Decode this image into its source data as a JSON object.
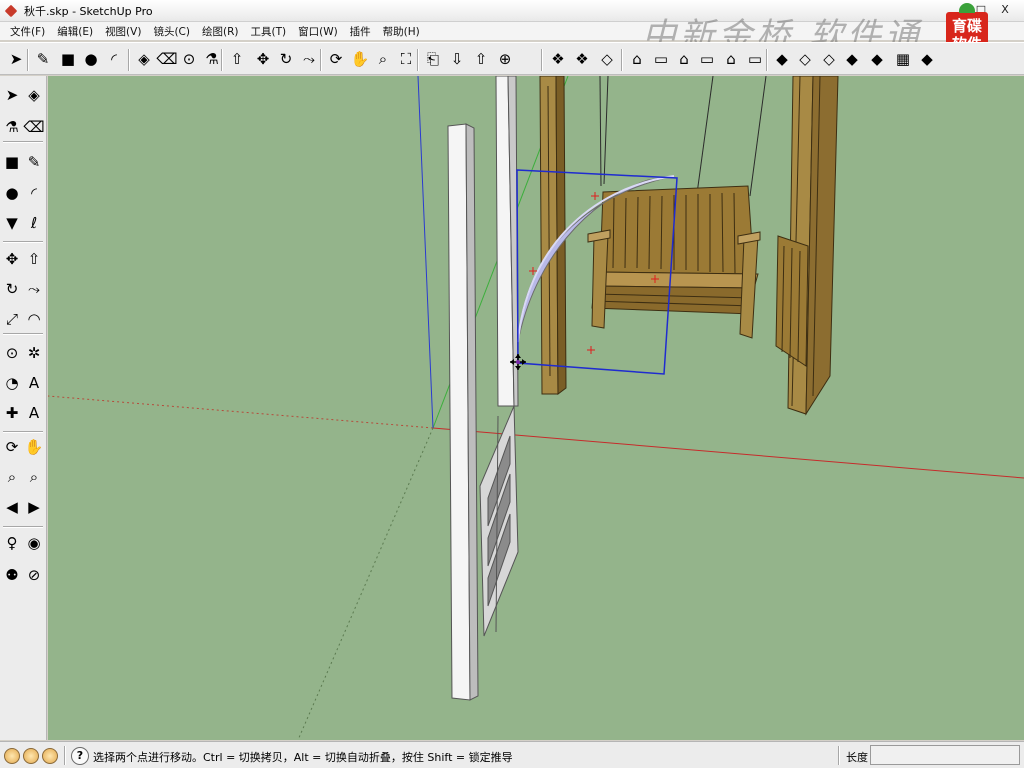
{
  "window": {
    "title": "秋千.skp - SketchUp Pro",
    "minimize_glyph": "–",
    "maximize_glyph": "□",
    "close_glyph": "X"
  },
  "menu": [
    {
      "label": "文件(F)"
    },
    {
      "label": "编辑(E)"
    },
    {
      "label": "视图(V)"
    },
    {
      "label": "镜头(C)"
    },
    {
      "label": "绘图(R)"
    },
    {
      "label": "工具(T)"
    },
    {
      "label": "窗口(W)"
    },
    {
      "label": "插件"
    },
    {
      "label": "帮助(H)"
    }
  ],
  "watermark": {
    "text": "中新金桥 软件通",
    "logo_text": "育碟软件"
  },
  "toolbar": {
    "items": [
      {
        "icon": "select-arrow-icon",
        "glyph": "➤"
      },
      {
        "icon": "pencil-line-icon",
        "glyph": "✎"
      },
      {
        "icon": "rectangle-icon",
        "glyph": "■"
      },
      {
        "icon": "circle-icon",
        "glyph": "●"
      },
      {
        "icon": "arc-icon",
        "glyph": "◜"
      },
      {
        "icon": "make-component-icon",
        "glyph": "◈"
      },
      {
        "icon": "eraser-icon",
        "glyph": "⌫"
      },
      {
        "icon": "tape-measure-icon",
        "glyph": "⊙"
      },
      {
        "icon": "paint-bucket-icon",
        "glyph": "⚗"
      },
      {
        "icon": "push-pull-icon",
        "glyph": "⇧"
      },
      {
        "icon": "move-icon",
        "glyph": "✥"
      },
      {
        "icon": "rotate-icon",
        "glyph": "↻"
      },
      {
        "icon": "follow-me-icon",
        "glyph": "⤳"
      },
      {
        "icon": "orbit-icon",
        "glyph": "⟳"
      },
      {
        "icon": "pan-icon",
        "glyph": "✋"
      },
      {
        "icon": "zoom-icon",
        "glyph": "⌕"
      },
      {
        "icon": "zoom-extents-icon",
        "glyph": "⛶"
      },
      {
        "icon": "previous-view-icon",
        "glyph": "⎗"
      },
      {
        "icon": "get-models-icon",
        "glyph": "⇩"
      },
      {
        "icon": "share-model-icon",
        "glyph": "⇧"
      },
      {
        "icon": "warehouse-icon",
        "glyph": "⊕"
      },
      {
        "icon": "get-components-icon",
        "glyph": "❖"
      },
      {
        "icon": "share-component-icon",
        "glyph": "❖"
      },
      {
        "icon": "extension-icon",
        "glyph": "◇"
      },
      {
        "icon": "iso-view-icon",
        "glyph": "⌂"
      },
      {
        "icon": "top-view-icon",
        "glyph": "▭"
      },
      {
        "icon": "front-view-icon",
        "glyph": "⌂"
      },
      {
        "icon": "right-view-icon",
        "glyph": "▭"
      },
      {
        "icon": "back-view-icon",
        "glyph": "⌂"
      },
      {
        "icon": "left-view-icon",
        "glyph": "▭"
      },
      {
        "icon": "xray-icon",
        "glyph": "◆"
      },
      {
        "icon": "wireframe-icon",
        "glyph": "◇"
      },
      {
        "icon": "hidden-line-icon",
        "glyph": "◇"
      },
      {
        "icon": "shaded-icon",
        "glyph": "◆"
      },
      {
        "icon": "shaded-textures-icon",
        "glyph": "◆"
      },
      {
        "icon": "monochrome-icon",
        "glyph": "▦"
      },
      {
        "icon": "styles-icon",
        "glyph": "◆"
      }
    ]
  },
  "left_toolbar": {
    "items": [
      {
        "icon": "select-icon",
        "glyph": "➤"
      },
      {
        "icon": "make-component-icon",
        "glyph": "◈"
      },
      {
        "icon": "paint-bucket-icon",
        "glyph": "⚗"
      },
      {
        "icon": "eraser-icon",
        "glyph": "⌫"
      },
      {
        "icon": "rectangle-icon",
        "glyph": "■"
      },
      {
        "icon": "line-icon",
        "glyph": "✎"
      },
      {
        "icon": "circle-icon",
        "glyph": "●"
      },
      {
        "icon": "arc-icon",
        "glyph": "◜"
      },
      {
        "icon": "polygon-icon",
        "glyph": "▼"
      },
      {
        "icon": "freehand-icon",
        "glyph": "ℓ"
      },
      {
        "icon": "move-icon",
        "glyph": "✥"
      },
      {
        "icon": "push-pull-icon",
        "glyph": "⇧"
      },
      {
        "icon": "rotate-icon",
        "glyph": "↻"
      },
      {
        "icon": "follow-me-icon",
        "glyph": "⤳"
      },
      {
        "icon": "scale-icon",
        "glyph": "⤢"
      },
      {
        "icon": "offset-icon",
        "glyph": "◠"
      },
      {
        "icon": "tape-measure-icon",
        "glyph": "⊙"
      },
      {
        "icon": "dimension-icon",
        "glyph": "✲"
      },
      {
        "icon": "protractor-icon",
        "glyph": "◔"
      },
      {
        "icon": "text-icon",
        "glyph": "A"
      },
      {
        "icon": "axes-icon",
        "glyph": "✚"
      },
      {
        "icon": "3d-text-icon",
        "glyph": "A"
      },
      {
        "icon": "orbit-icon",
        "glyph": "⟳"
      },
      {
        "icon": "pan-icon",
        "glyph": "✋"
      },
      {
        "icon": "zoom-icon",
        "glyph": "⌕"
      },
      {
        "icon": "zoom-window-icon",
        "glyph": "⌕"
      },
      {
        "icon": "previous-icon",
        "glyph": "◀"
      },
      {
        "icon": "next-icon",
        "glyph": "▶"
      },
      {
        "icon": "position-camera-icon",
        "glyph": "♀"
      },
      {
        "icon": "look-around-icon",
        "glyph": "◉"
      },
      {
        "icon": "walk-icon",
        "glyph": "⚉"
      },
      {
        "icon": "section-plane-icon",
        "glyph": "⊘"
      }
    ]
  },
  "status": {
    "geo_icon": "geo-location-icon",
    "credits_icon": "credits-icon",
    "user_icon": "user-icon",
    "help_glyph": "?",
    "message": "选择两个点进行移动。Ctrl = 切换拷贝，Alt = 切换自动折叠，按住 Shift = 锁定推导",
    "measure_label": "长度",
    "measure_value": ""
  },
  "colors": {
    "viewport_background": "#94b48b",
    "selection_blue": "#1f2bd0",
    "axis_red": "#c62b2b",
    "axis_green": "#3cae3c",
    "axis_blue": "#2a3ad0",
    "wood": "#9b7a35",
    "white_post": "#f2f2f2"
  }
}
